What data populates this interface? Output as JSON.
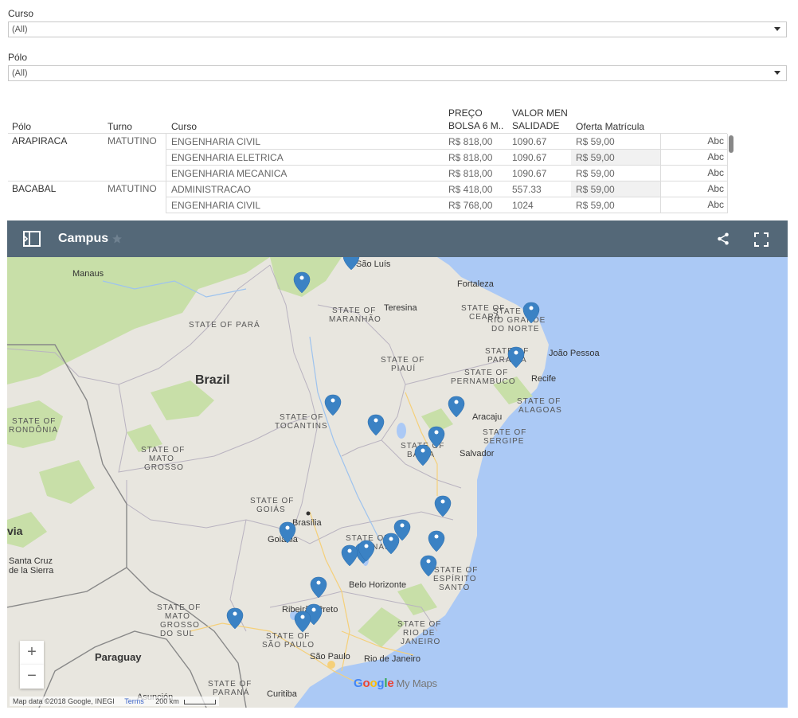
{
  "filters": {
    "curso": {
      "label": "Curso",
      "value": "(All)"
    },
    "polo": {
      "label": "Pólo",
      "value": "(All)"
    }
  },
  "table": {
    "headers": {
      "polo": "Pólo",
      "turno": "Turno",
      "curso": "Curso",
      "preco_l1": "PREÇO",
      "preco_l2": "BOLSA 6 M..",
      "valor_l1": "VALOR MEN",
      "valor_l2": "SALIDADE",
      "oferta": "Oferta Matrícula"
    },
    "rows": [
      {
        "polo": "ARAPIRACA",
        "turno": "MATUTINO",
        "curso": "ENGENHARIA CIVIL",
        "preco": "R$ 818,00",
        "valor": "1090.67",
        "oferta": "R$ 59,00",
        "abc": "Abc"
      },
      {
        "polo": "",
        "turno": "",
        "curso": "ENGENHARIA ELETRICA",
        "preco": "R$ 818,00",
        "valor": "1090.67",
        "oferta": "R$ 59,00",
        "abc": "Abc"
      },
      {
        "polo": "",
        "turno": "",
        "curso": "ENGENHARIA MECANICA",
        "preco": "R$ 818,00",
        "valor": "1090.67",
        "oferta": "R$ 59,00",
        "abc": "Abc"
      },
      {
        "polo": "BACABAL",
        "turno": "MATUTINO",
        "curso": "ADMINISTRACAO",
        "preco": "R$ 418,00",
        "valor": "557.33",
        "oferta": "R$ 59,00",
        "abc": "Abc"
      },
      {
        "polo": "",
        "turno": "",
        "curso": "ENGENHARIA CIVIL",
        "preco": "R$ 768,00",
        "valor": "1024",
        "oferta": "R$ 59,00",
        "abc": "Abc"
      }
    ]
  },
  "map": {
    "title": "Campus",
    "zoom_in": "+",
    "zoom_out": "−",
    "attribution": "Map data ©2018 Google, INEGI",
    "terms": "Terms",
    "scale": "200 km",
    "logo_google": "Google",
    "logo_mymaps": "My Maps",
    "colors": {
      "header": "#546878",
      "ocean": "#abc9f5",
      "land": "#e8e6df",
      "marker": "#3b82c4",
      "green": "#c8dfa8"
    },
    "labels": {
      "manaus": "Manaus",
      "sao_luis": "São Luís",
      "fortaleza": "Fortaleza",
      "teresina": "Teresina",
      "para": "STATE OF PARÁ",
      "maranhao_1": "STATE OF",
      "maranhao_2": "MARANHÃO",
      "ceara_1": "STATE OF",
      "ceara_2": "CEARÁ",
      "rn_1": "STATE OF",
      "rn_2": "RIO GRANDE",
      "rn_3": "DO NORTE",
      "joao_pessoa": "João Pessoa",
      "paraiba_1": "STATE OF",
      "paraiba_2": "PARAÍBA",
      "brazil": "Brazil",
      "piaui_1": "STATE OF",
      "piaui_2": "PIAUÍ",
      "pernambuco_1": "STATE OF",
      "pernambuco_2": "PERNAMBUCO",
      "recife": "Recife",
      "rondonia_1": "STATE OF",
      "rondonia_2": "RONDÔNIA",
      "tocantins_1": "STATE OF",
      "tocantins_2": "TOCANTINS",
      "alagoas_1": "STATE OF",
      "alagoas_2": "ALAGOAS",
      "aracaju": "Aracaju",
      "sergipe_1": "STATE OF",
      "sergipe_2": "SERGIPE",
      "bahia_1": "STATE OF",
      "bahia_2": "BAHIA",
      "salvador": "Salvador",
      "mato_grosso_1": "STATE OF",
      "mato_grosso_2": "MATO",
      "mato_grosso_3": "GROSSO",
      "goias_1": "STATE OF",
      "goias_2": "GOIÁS",
      "brasilia": "Brasília",
      "goiania": "Goiânia",
      "bolivia": "via",
      "mg_1": "STATE OF",
      "mg_2": "MINAS",
      "santa_cruz_1": "Santa Cruz",
      "santa_cruz_2": "de la Sierra",
      "es_1": "STATE OF",
      "es_2": "ESPÍRITO",
      "es_3": "SANTO",
      "bh": "Belo Horizonte",
      "ms_1": "STATE OF",
      "ms_2": "MATO",
      "ms_3": "GROSSO",
      "ms_4": "DO SUL",
      "ribeirao": "Ribeirão Preto",
      "sp_1": "STATE OF",
      "sp_2": "SÃO PAULO",
      "rj_1": "STATE OF",
      "rj_2": "RIO DE",
      "rj_3": "JANEIRO",
      "paraguay": "Paraguay",
      "sao_paulo": "São Paulo",
      "rio": "Rio de Janeiro",
      "pr_1": "STATE OF",
      "pr_2": "PARANÁ",
      "curitiba": "Curitiba",
      "asuncion": "Asunción"
    }
  }
}
